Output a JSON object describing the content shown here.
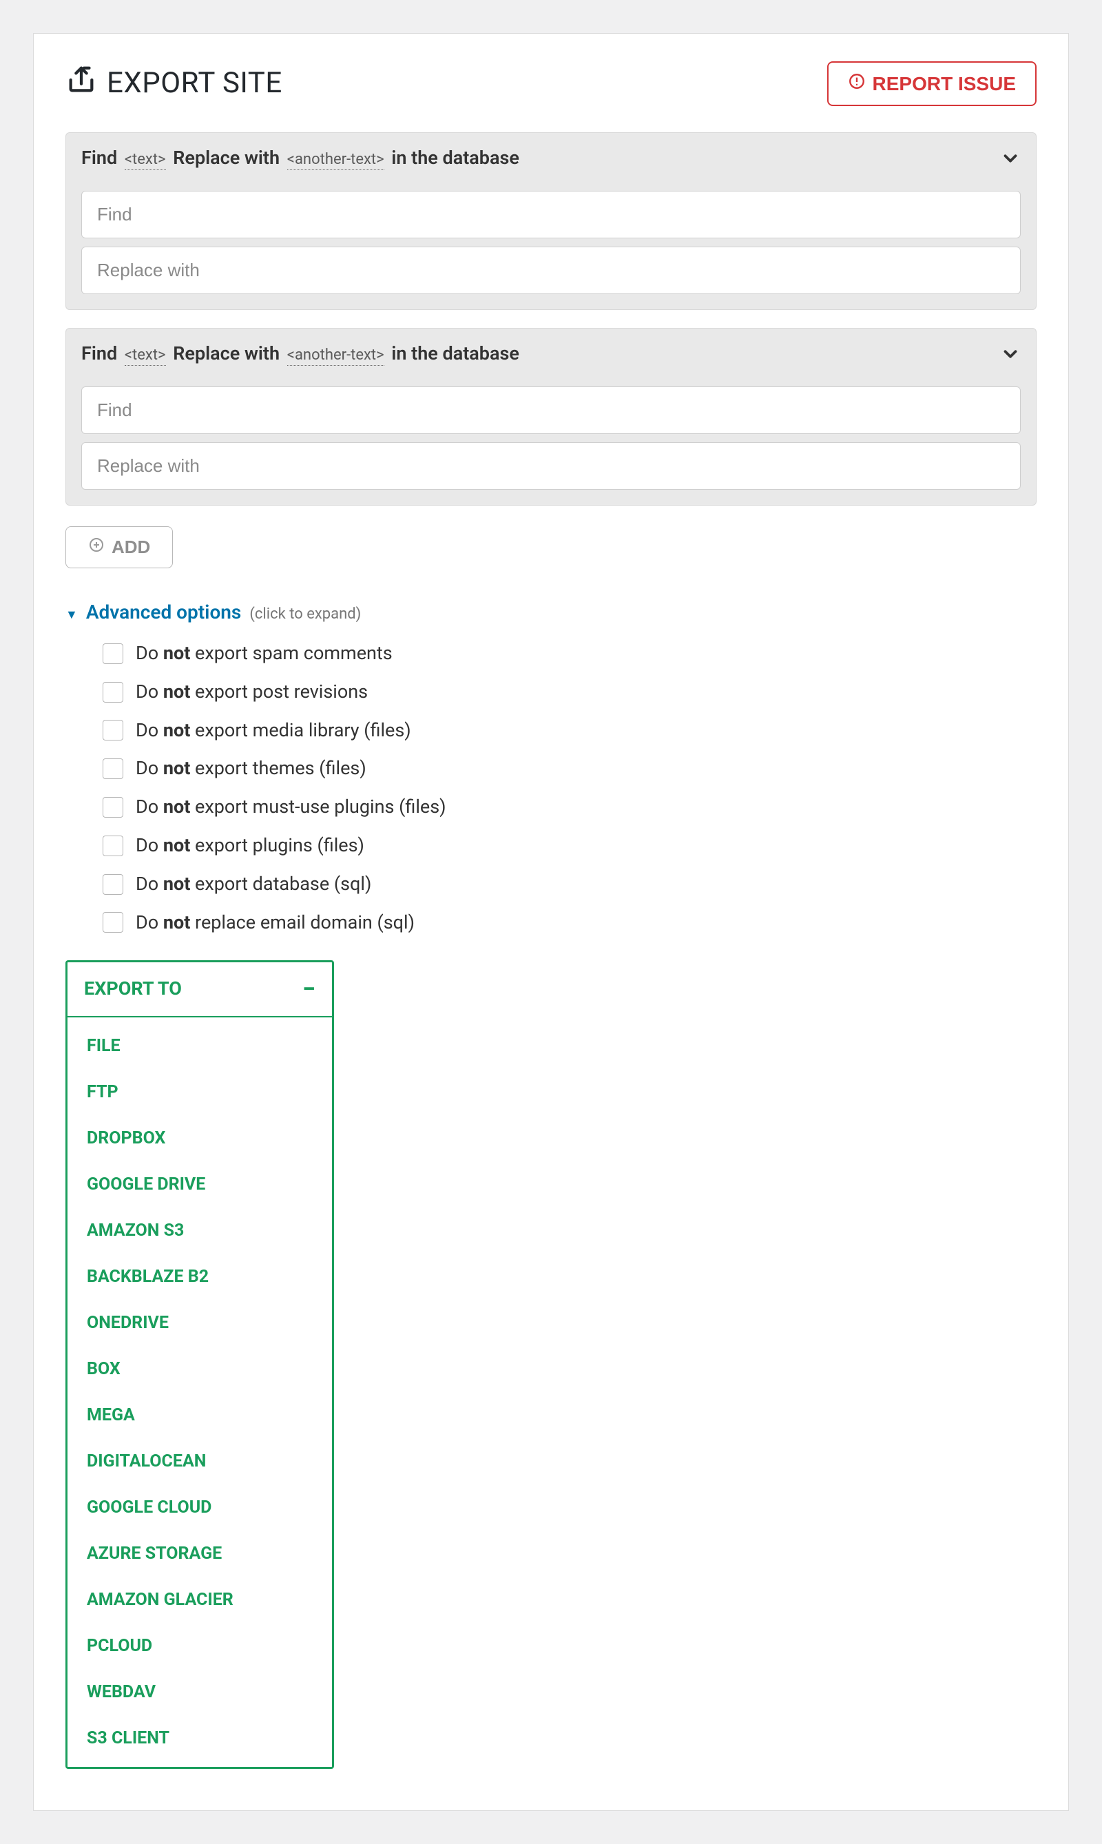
{
  "header": {
    "title": "EXPORT SITE",
    "report_label": "REPORT ISSUE"
  },
  "find_replace": {
    "desc_prefix": "Find",
    "desc_tag1": "<text>",
    "desc_mid": "Replace with",
    "desc_tag2": "<another-text>",
    "desc_suffix": "in the database",
    "find_placeholder": "Find",
    "replace_placeholder": "Replace with"
  },
  "add_button": "ADD",
  "advanced": {
    "label": "Advanced options",
    "hint": "(click to expand)",
    "options": [
      {
        "pre": "Do ",
        "bold": "not",
        "post": " export spam comments"
      },
      {
        "pre": "Do ",
        "bold": "not",
        "post": " export post revisions"
      },
      {
        "pre": "Do ",
        "bold": "not",
        "post": " export media library (files)"
      },
      {
        "pre": "Do ",
        "bold": "not",
        "post": " export themes (files)"
      },
      {
        "pre": "Do ",
        "bold": "not",
        "post": " export must-use plugins (files)"
      },
      {
        "pre": "Do ",
        "bold": "not",
        "post": " export plugins (files)"
      },
      {
        "pre": "Do ",
        "bold": "not",
        "post": " export database (sql)"
      },
      {
        "pre": "Do ",
        "bold": "not",
        "post": " replace email domain (sql)"
      }
    ]
  },
  "export_menu": {
    "header": "EXPORT TO",
    "items": [
      "FILE",
      "FTP",
      "DROPBOX",
      "GOOGLE DRIVE",
      "AMAZON S3",
      "BACKBLAZE B2",
      "ONEDRIVE",
      "BOX",
      "MEGA",
      "DIGITALOCEAN",
      "GOOGLE CLOUD",
      "AZURE STORAGE",
      "AMAZON GLACIER",
      "PCLOUD",
      "WEBDAV",
      "S3 CLIENT"
    ]
  }
}
